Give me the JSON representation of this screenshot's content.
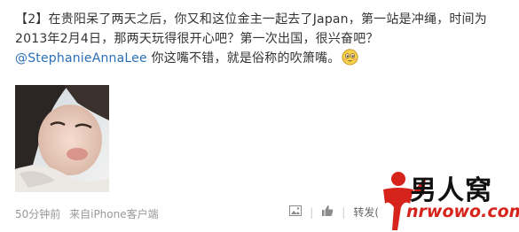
{
  "post": {
    "text_before_mention": "【2】在贵阳呆了两天之后，你又和这位金主一起去了Japan，第一站是冲绳，时间为2013年2月4日，那两天玩得很开心吧？第一次出国，很兴奋吧？",
    "mention": "@StephanieAnnaLee",
    "text_after_mention": " 你这嘴不错，就是俗称的吹箫嘴。",
    "emoji_icon": "blushing-smiley-icon"
  },
  "meta": {
    "time": "50分钟前",
    "source": "来自iPhone客户端"
  },
  "actions": {
    "share_label": "转发(",
    "icons": [
      "picture-icon",
      "thumbs-up-icon"
    ]
  },
  "watermark": {
    "title": "男人窝",
    "url": "nrwowo.com",
    "colors": {
      "red": "#d6231c",
      "black": "#111111"
    }
  },
  "colors": {
    "text": "#333333",
    "link": "#2a6fb8",
    "meta": "#999999"
  }
}
